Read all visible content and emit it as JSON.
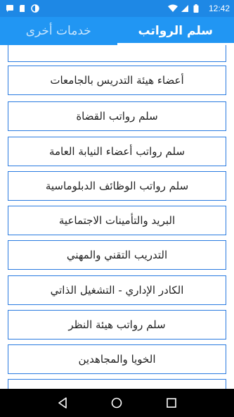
{
  "status_bar": {
    "time": "12:42",
    "icons": [
      "sms-icon",
      "sd-card-icon",
      "status-circle-icon",
      "wifi-icon",
      "signal-icon",
      "battery-icon"
    ]
  },
  "tabs": [
    {
      "label": "خدمات أخرى",
      "active": false
    },
    {
      "label": "سلم الرواتب",
      "active": true
    }
  ],
  "list": {
    "items": [
      {
        "label": ""
      },
      {
        "label": "أعضاء هيئة التدريس بالجامعات"
      },
      {
        "label": "سلم رواتب القضاة"
      },
      {
        "label": "سلم رواتب أعضاء النيابة العامة"
      },
      {
        "label": "سلم رواتب الوظائف الدبلوماسية"
      },
      {
        "label": "البريد والتأمينات الاجتماعية"
      },
      {
        "label": "التدريب التقني والمهني"
      },
      {
        "label": "الكادر الإداري - التشغيل الذاتي"
      },
      {
        "label": "سلم رواتب هيئة النظر"
      },
      {
        "label": "الخويا والمجاهدين"
      },
      {
        "label": ""
      }
    ]
  },
  "nav_bar": {
    "icons": [
      "back-icon",
      "home-icon",
      "recents-icon"
    ]
  },
  "colors": {
    "status_bar": "#1e88e5",
    "app_bar": "#2196f3",
    "item_border": "#2a7be0",
    "nav_bar": "#000000"
  }
}
